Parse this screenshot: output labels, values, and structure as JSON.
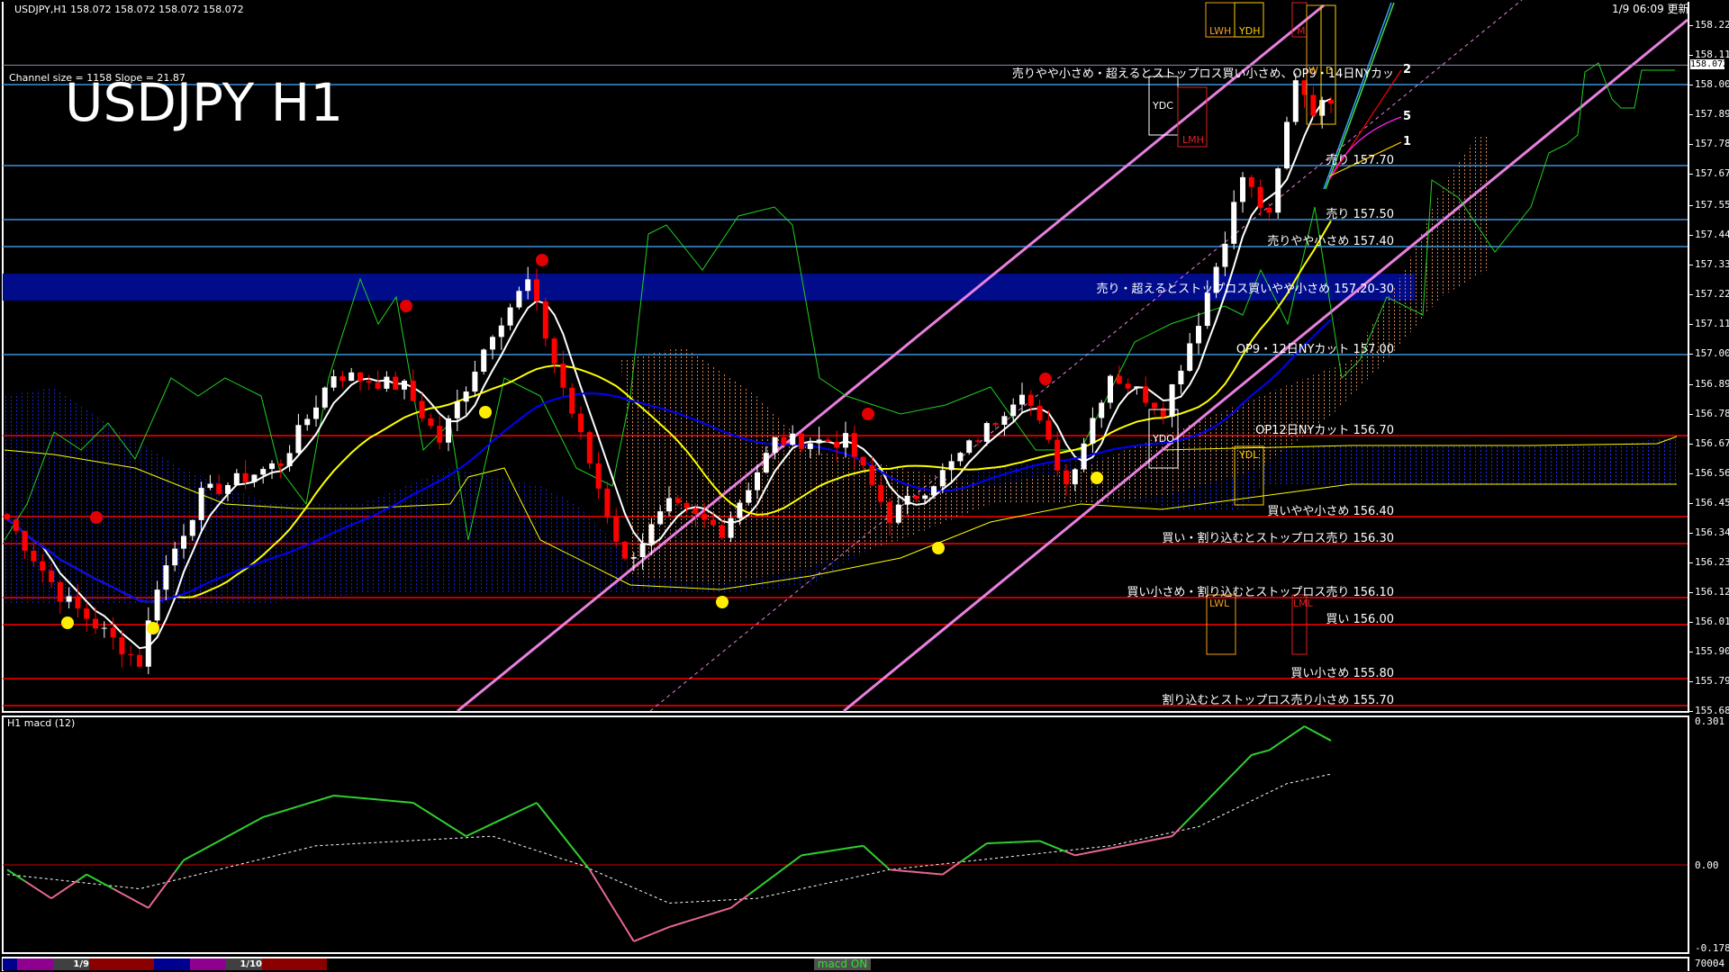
{
  "header": {
    "symbol_info": "USDJPY,H1  158.072 158.072 158.072 158.072",
    "channel_info": "Channel size = 1158 Slope = 21.87",
    "big_title": "USDJPY H1",
    "updated": "1/9 06:09 更新"
  },
  "price_axis": {
    "ticks": [
      "158.220",
      "158.110",
      "158.000",
      "157.890",
      "157.780",
      "157.670",
      "157.555",
      "157.445",
      "157.335",
      "157.225",
      "157.115",
      "157.005",
      "156.890",
      "156.780",
      "156.670",
      "156.560",
      "156.450",
      "156.340",
      "156.230",
      "156.120",
      "156.010",
      "155.900",
      "155.790",
      "155.680"
    ],
    "tick_values": [
      158.22,
      158.11,
      158.0,
      157.89,
      157.78,
      157.67,
      157.555,
      157.445,
      157.335,
      157.225,
      157.115,
      157.005,
      156.89,
      156.78,
      156.67,
      156.56,
      156.45,
      156.34,
      156.23,
      156.12,
      156.01,
      155.9,
      155.79,
      155.68
    ],
    "current_price": "158.072",
    "current_value": 158.072
  },
  "levels": [
    {
      "text": "売りやや小さめ・超えるとストップロス買い小さめ、OP9・14日NYカッ",
      "price": 158.0,
      "color": "#3a8fd8"
    },
    {
      "text": "売り 157.70",
      "price": 157.7,
      "color": "#3a8fd8"
    },
    {
      "text": "売り 157.50",
      "price": 157.5,
      "color": "#3a8fd8"
    },
    {
      "text": "売りやや小さめ 157.40",
      "price": 157.4,
      "color": "#3a8fd8"
    },
    {
      "text": "売り・超えるとストップロス買いやや小さめ 157.20-30",
      "price": 157.2,
      "color": "#000c8a",
      "band_top": 157.3
    },
    {
      "text": "OP9・12日NYカット 157.00",
      "price": 157.0,
      "color": "#3a8fd8"
    },
    {
      "text": "OP12日NYカット 156.70",
      "price": 156.7,
      "color": "#ff0000"
    },
    {
      "text": "買いやや小さめ 156.40",
      "price": 156.4,
      "color": "#ff0000"
    },
    {
      "text": "買い・割り込むとストップロス売り 156.30",
      "price": 156.3,
      "color": "#ff0000"
    },
    {
      "text": "買い小さめ・割り込むとストップロス売り 156.10",
      "price": 156.1,
      "color": "#ff0000"
    },
    {
      "text": "買い 156.00",
      "price": 156.0,
      "color": "#ff0000"
    },
    {
      "text": "買い小さめ 155.80",
      "price": 155.8,
      "color": "#ff0000"
    },
    {
      "text": "割り込むとストップロス売り小さめ 155.70",
      "price": 155.7,
      "color": "#ff0000"
    }
  ],
  "fan_labels": [
    "2",
    "5",
    "1"
  ],
  "boxes": {
    "lwh": "LWH",
    "ydh": "YDH",
    "m": "M",
    "w": "W",
    "d": "D",
    "ydc": "YDC",
    "lmh": "LMH",
    "ydo": "YDO",
    "ydl": "YDL",
    "lwl": "LWL",
    "lml": "LML"
  },
  "chart_data": {
    "type": "candlestick",
    "title": "USDJPY H1",
    "price_keypoints": [
      [
        0,
        156.39
      ],
      [
        6,
        156.11
      ],
      [
        15,
        155.86
      ],
      [
        17,
        156.15
      ],
      [
        22,
        156.48
      ],
      [
        31,
        156.6
      ],
      [
        37,
        156.93
      ],
      [
        45,
        156.88
      ],
      [
        49,
        156.68
      ],
      [
        55,
        157.09
      ],
      [
        59,
        157.27
      ],
      [
        62,
        156.97
      ],
      [
        66,
        156.6
      ],
      [
        70,
        156.23
      ],
      [
        75,
        156.44
      ],
      [
        81,
        156.35
      ],
      [
        87,
        156.68
      ],
      [
        95,
        156.68
      ],
      [
        100,
        156.4
      ],
      [
        106,
        156.56
      ],
      [
        112,
        156.76
      ],
      [
        115,
        156.88
      ],
      [
        120,
        156.52
      ],
      [
        125,
        156.93
      ],
      [
        131,
        156.8
      ],
      [
        135,
        157.13
      ],
      [
        137,
        157.33
      ],
      [
        140,
        157.66
      ],
      [
        143,
        157.5
      ],
      [
        146,
        158.03
      ],
      [
        148,
        157.91
      ],
      [
        150,
        157.93
      ]
    ],
    "ylim": [
      155.68,
      158.22
    ],
    "moving_averages": [
      {
        "period": 5,
        "color": "#ffffff"
      },
      {
        "period": 20,
        "color": "#ffff00"
      },
      {
        "period": 40,
        "color": "#0000ff"
      }
    ]
  },
  "macd": {
    "title": "H1  macd (12)",
    "axis_top": "0.301",
    "axis_zero": "0.00",
    "axis_bottom": "-0.178",
    "ylim": [
      -0.178,
      0.301
    ],
    "main_keypoints": [
      [
        0,
        -0.01
      ],
      [
        5,
        -0.07
      ],
      [
        9,
        -0.02
      ],
      [
        16,
        -0.09
      ],
      [
        20,
        0.01
      ],
      [
        29,
        0.1
      ],
      [
        37,
        0.145
      ],
      [
        46,
        0.13
      ],
      [
        52,
        0.06
      ],
      [
        60,
        0.13
      ],
      [
        66,
        -0.01
      ],
      [
        71,
        -0.16
      ],
      [
        75,
        -0.13
      ],
      [
        82,
        -0.09
      ],
      [
        90,
        0.02
      ],
      [
        97,
        0.04
      ],
      [
        100,
        -0.01
      ],
      [
        106,
        -0.02
      ],
      [
        111,
        0.045
      ],
      [
        117,
        0.05
      ],
      [
        121,
        0.02
      ],
      [
        132,
        0.06
      ],
      [
        141,
        0.23
      ],
      [
        143,
        0.24
      ],
      [
        147,
        0.29
      ],
      [
        150,
        0.26
      ]
    ],
    "signal_keypoints": [
      [
        0,
        -0.02
      ],
      [
        15,
        -0.05
      ],
      [
        35,
        0.04
      ],
      [
        55,
        0.06
      ],
      [
        65,
        0.0
      ],
      [
        75,
        -0.08
      ],
      [
        85,
        -0.07
      ],
      [
        100,
        -0.01
      ],
      [
        115,
        0.02
      ],
      [
        125,
        0.04
      ],
      [
        135,
        0.08
      ],
      [
        145,
        0.17
      ],
      [
        150,
        0.19
      ]
    ]
  },
  "volume_label": "70004",
  "bottom_strip": {
    "day1": "1/9",
    "day2": "1/10",
    "macd_status": "macd ON"
  }
}
